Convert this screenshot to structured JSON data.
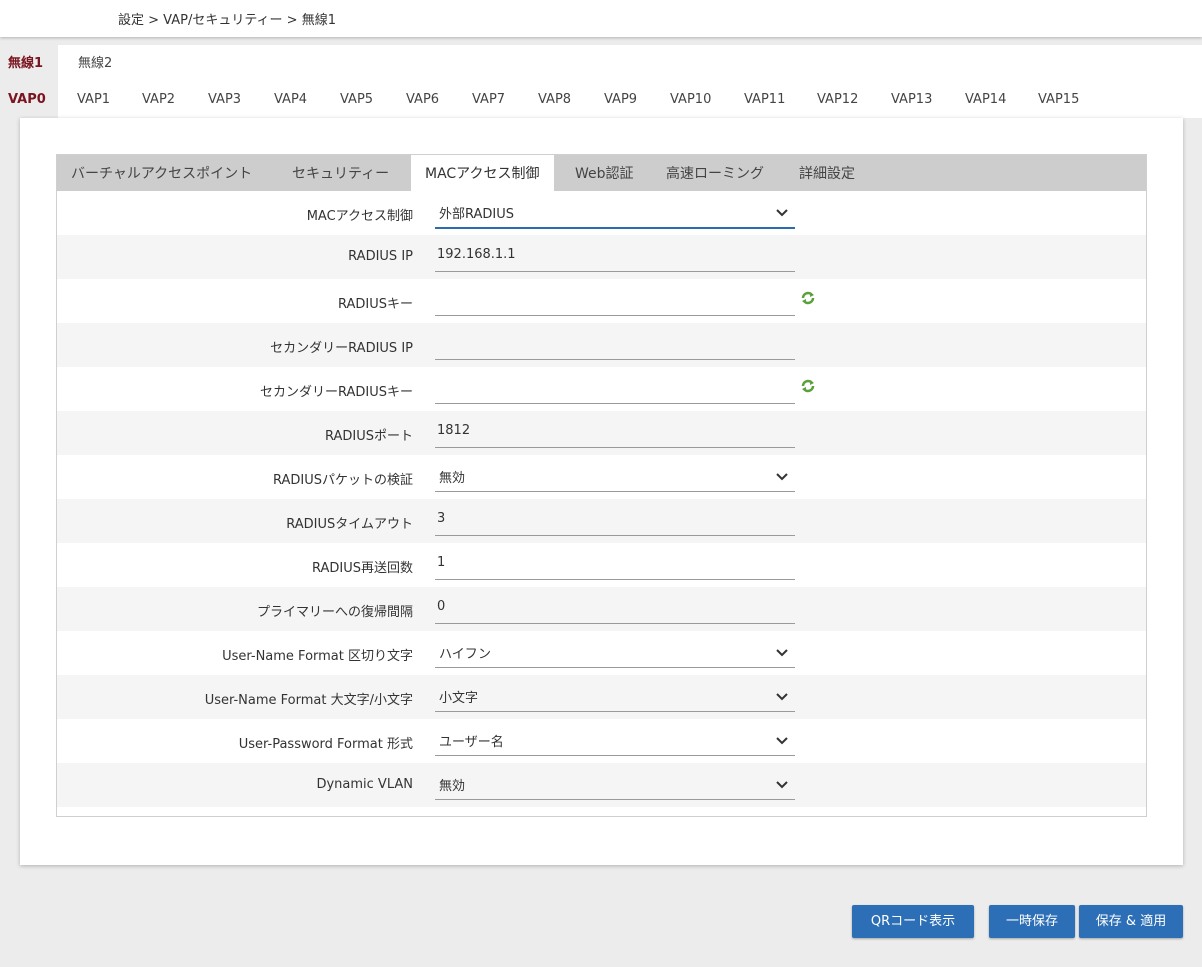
{
  "breadcrumb": "設定 > VAP/セキュリティー > 無線1",
  "radio_tabs": {
    "active": "無線1",
    "inactive": "無線2"
  },
  "vap_tabs": [
    "VAP0",
    "VAP1",
    "VAP2",
    "VAP3",
    "VAP4",
    "VAP5",
    "VAP6",
    "VAP7",
    "VAP8",
    "VAP9",
    "VAP10",
    "VAP11",
    "VAP12",
    "VAP13",
    "VAP14",
    "VAP15"
  ],
  "sub_tabs": [
    "バーチャルアクセスポイント",
    "セキュリティー",
    "MACアクセス制御",
    "Web認証",
    "高速ローミング",
    "詳細設定"
  ],
  "form": {
    "mac_access_control": {
      "label": "MACアクセス制御",
      "value": "外部RADIUS"
    },
    "radius_ip": {
      "label": "RADIUS IP",
      "value": "192.168.1.1"
    },
    "radius_key": {
      "label": "RADIUSキー",
      "value": ""
    },
    "secondary_radius_ip": {
      "label": "セカンダリーRADIUS IP",
      "value": ""
    },
    "secondary_radius_key": {
      "label": "セカンダリーRADIUSキー",
      "value": ""
    },
    "radius_port": {
      "label": "RADIUSポート",
      "value": "1812"
    },
    "radius_packet_verify": {
      "label": "RADIUSパケットの検証",
      "value": "無効"
    },
    "radius_timeout": {
      "label": "RADIUSタイムアウト",
      "value": "3"
    },
    "radius_retries": {
      "label": "RADIUS再送回数",
      "value": "1"
    },
    "primary_return_interval": {
      "label": "プライマリーへの復帰間隔",
      "value": "0"
    },
    "username_delimiter": {
      "label": "User-Name Format 区切り文字",
      "value": "ハイフン"
    },
    "username_case": {
      "label": "User-Name Format 大文字/小文字",
      "value": "小文字"
    },
    "userpassword_format": {
      "label": "User-Password Format 形式",
      "value": "ユーザー名"
    },
    "dynamic_vlan": {
      "label": "Dynamic VLAN",
      "value": "無効"
    }
  },
  "buttons": {
    "qr": "QRコード表示",
    "temp_save": "一時保存",
    "save_apply": "保存 & 適用"
  },
  "colors": {
    "accent": "#2d6fb6",
    "active_tab": "#7a1520",
    "refresh_icon": "#5aa03c"
  }
}
